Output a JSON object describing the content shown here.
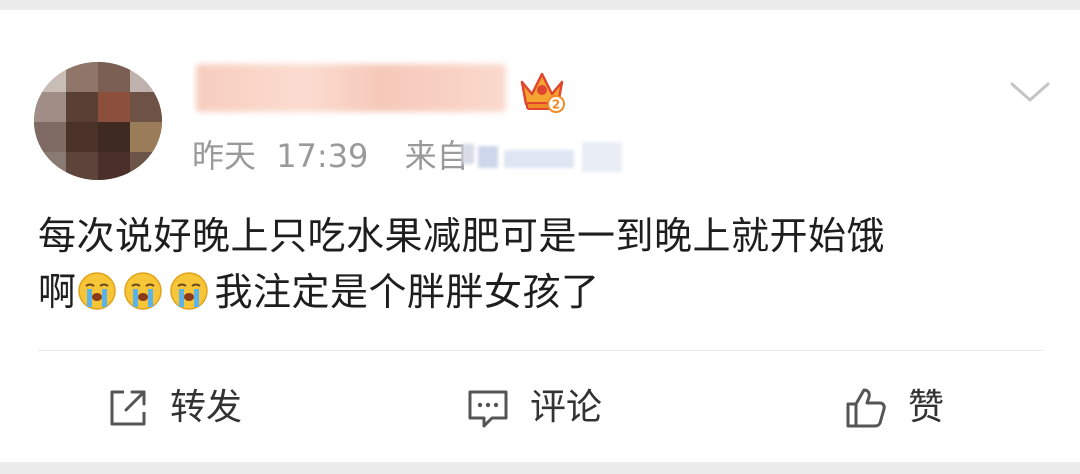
{
  "post": {
    "user": {
      "name": "",
      "avatar": "pixelated-avatar",
      "badge": "crown-level-badge",
      "badge_level": "2"
    },
    "meta": {
      "day": "昨天",
      "time": "17:39",
      "source_prefix": "来自",
      "source": ""
    },
    "content": {
      "line1": "每次说好晚上只吃水果减肥可是一到晚上就开始饿",
      "line2_prefix": "啊",
      "emoji": "crying-face-icon",
      "line2_suffix": "我注定是个胖胖女孩了"
    },
    "more_icon": "chevron-down-icon"
  },
  "actions": {
    "repost": {
      "label": "转发",
      "icon": "share-icon"
    },
    "comment": {
      "label": "评论",
      "icon": "comment-icon"
    },
    "like": {
      "label": "赞",
      "icon": "thumbs-up-icon"
    }
  },
  "colors": {
    "text_primary": "#1e1e1e",
    "text_secondary": "#9a9a9a",
    "badge_orange": "#f08a24",
    "badge_red": "#e0452f",
    "emoji_yellow": "#f7c538",
    "tear_blue": "#5ab4ea"
  }
}
